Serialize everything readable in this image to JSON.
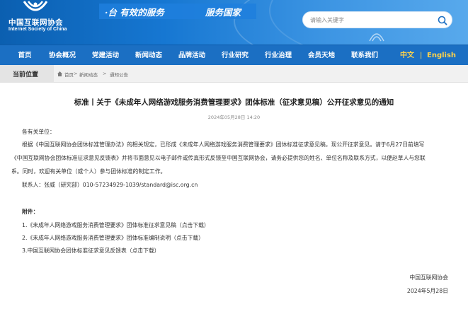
{
  "header": {
    "logo_cn": "中国互联网协会",
    "logo_en": "Internet Society of China",
    "slogan_left": "·台  有效的服务",
    "slogan_right": "服务国家",
    "search_placeholder": "请输入关键字"
  },
  "nav": {
    "items": [
      "首页",
      "协会概况",
      "党建活动",
      "新闻动态",
      "品牌活动",
      "行业研究",
      "行业治理",
      "会员天地",
      "联系我们"
    ],
    "lang_cn": "中文",
    "lang_sep": "|",
    "lang_en": "English"
  },
  "breadcrumb": {
    "title": "当前位置",
    "items": [
      "首页",
      "新闻动态",
      "通知公告"
    ],
    "sep": ">"
  },
  "article": {
    "title": "标准丨关于《未成年人网络游戏服务消费管理要求》团体标准（征求意见稿）公开征求意见的通知",
    "date": "2024年05月28日 14:20",
    "salutation": "各有关单位：",
    "body_lines": [
      "根据《中国互联网协会团体标准管理办法》的相关规定，已形成《未成年人网络游戏服务消费管理要求》团体标准征求意见稿，现公开征求意见。请于6月27日前填写",
      "《中国互联网协会团体标准征求意见反馈表》并将书面意见以电子邮件或传真形式反馈至中国互联网协会，请务必提供您的姓名、单位名称及联系方式，以便赵草人与您联",
      "系。同时，欢迎有关单位（或个人）参与团体标准的制定工作。"
    ],
    "contact": "联系人：张威（研究部）010-57234929-1039/standard@isc.org.cn",
    "attachments_label": "附件：",
    "attachments": [
      "1.《未成年人网络游戏服务消费管理要求》团体标准征求意见稿（点击下载）",
      "2.《未成年人网络游戏服务消费管理要求》团体标准编制说明（点击下载）",
      "3.中国互联网协会团体标准征求意见反馈表（点击下载）"
    ],
    "signature_org": "中国互联网协会",
    "signature_date": "2024年5月28日"
  },
  "colors": {
    "header_blue": "#1677d2",
    "nav_blue": "#1b6fc3",
    "lang_yellow": "#ffd24a"
  }
}
